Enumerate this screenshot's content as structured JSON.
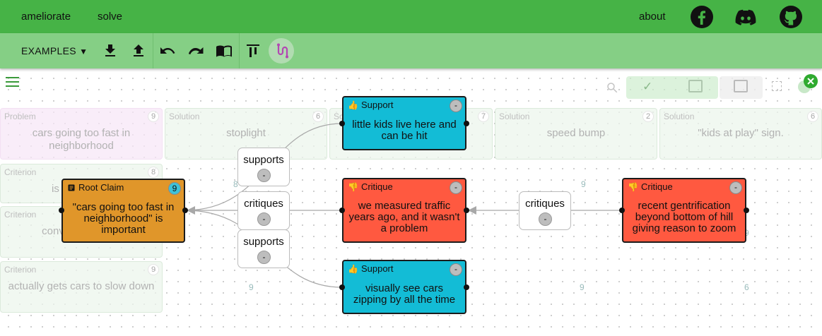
{
  "nav": {
    "brand": "ameliorate",
    "solve": "solve",
    "about": "about"
  },
  "social": {
    "facebook": "facebook-icon",
    "discord": "discord-icon",
    "github": "github-icon"
  },
  "toolbar": {
    "examples_label": "EXAMPLES"
  },
  "background_table": {
    "problem": {
      "header": "Problem",
      "text": "cars going too fast in neighborhood",
      "score": "9"
    },
    "solutions": [
      {
        "header": "Solution",
        "text": "stoplight",
        "score": "6"
      },
      {
        "header": "Solution",
        "text": "",
        "score": "7"
      },
      {
        "header": "Solution",
        "text": "speed bump",
        "score": "2"
      },
      {
        "header": "Solution",
        "text": "\"kids at play\" sign.",
        "score": "6"
      }
    ],
    "criteria": [
      {
        "header": "Criterion",
        "text": "is",
        "score": "8"
      },
      {
        "header": "Criterion",
        "text": "conveys m down",
        "score": ""
      },
      {
        "header": "Criterion",
        "text": "actually gets cars to slow down",
        "score": "9"
      }
    ],
    "cell_scores": [
      "8",
      "9",
      "9",
      "9",
      "9",
      "6"
    ]
  },
  "nodes": {
    "root": {
      "type": "Root Claim",
      "text": "\"cars going too fast in neighborhood\" is important",
      "score": "9"
    },
    "support1": {
      "type": "Support",
      "text": "little kids live here and can be hit",
      "score": "-"
    },
    "critique1": {
      "type": "Critique",
      "text": "we measured traffic years ago, and it wasn't a problem",
      "score": "-"
    },
    "support2": {
      "type": "Support",
      "text": "visually see cars zipping by all the time",
      "score": "-"
    },
    "critique2": {
      "type": "Critique",
      "text": "recent gentrification beyond bottom of hill giving reason to zoom",
      "score": "-"
    }
  },
  "edges": {
    "e1": {
      "label": "supports",
      "score": "-"
    },
    "e2": {
      "label": "critiques",
      "score": "-"
    },
    "e3": {
      "label": "supports",
      "score": "-"
    },
    "e4": {
      "label": "critiques",
      "score": "-"
    }
  },
  "colors": {
    "topbar": "#46b346",
    "toolbar": "#85cf85",
    "root": "#e0962a",
    "support": "#13bcd6",
    "critique": "#ff5940"
  }
}
